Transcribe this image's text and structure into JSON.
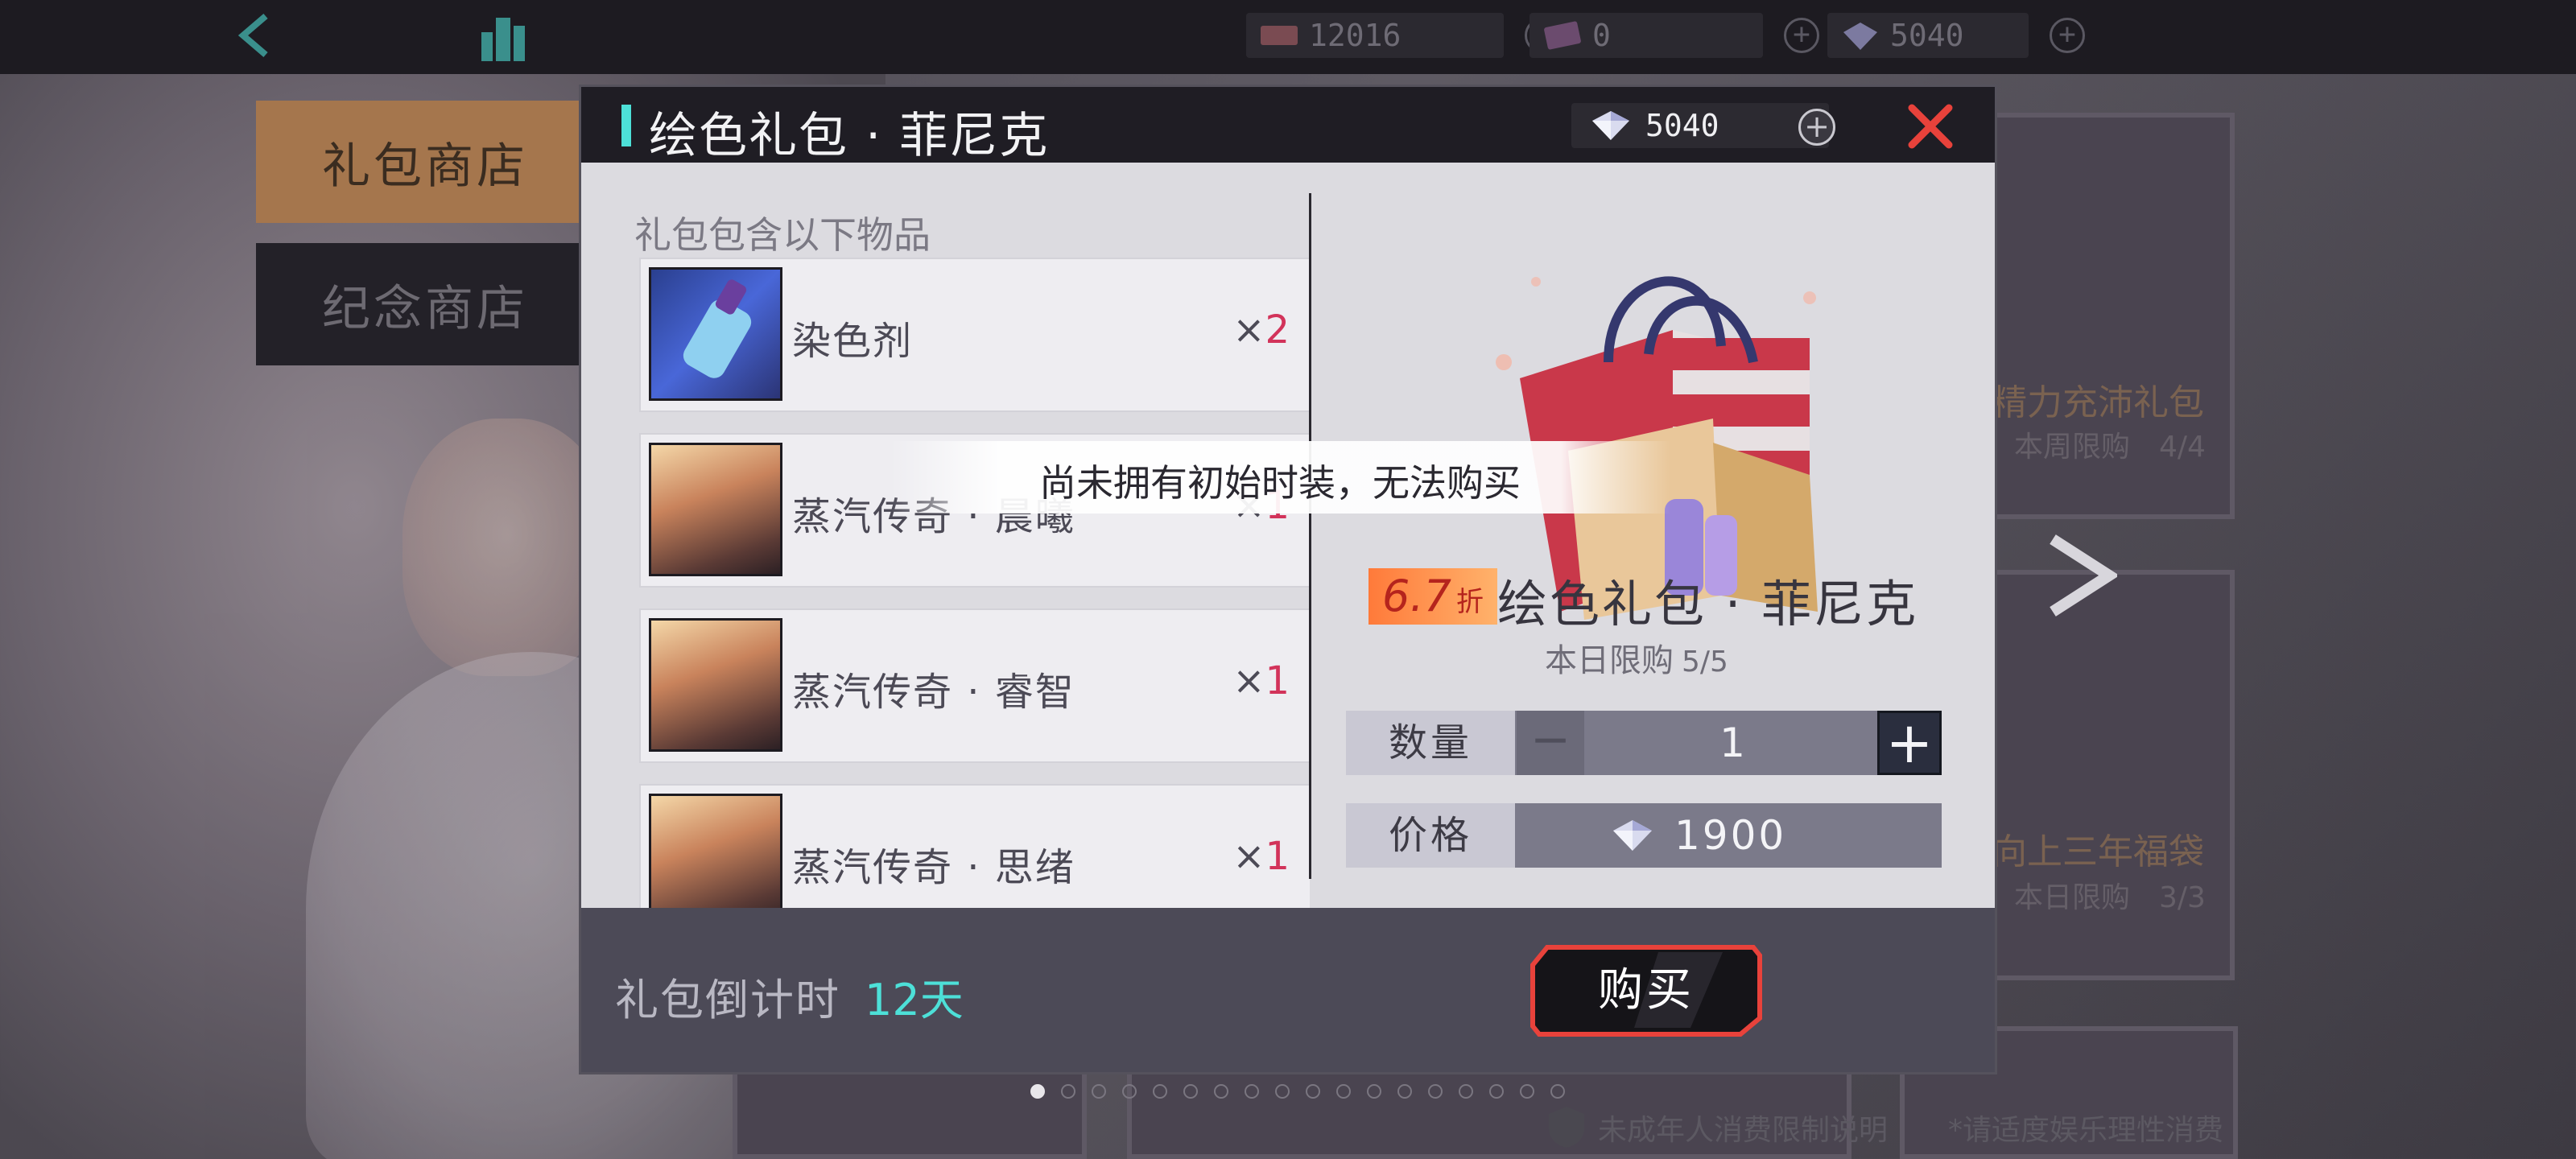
{
  "topbar": {
    "currencies": [
      {
        "name": "ticket",
        "value": "12016"
      },
      {
        "name": "coupon",
        "value": "0"
      },
      {
        "name": "gem",
        "value": "5040"
      }
    ]
  },
  "sidebar": {
    "tabs": [
      {
        "label": "礼包商店",
        "active": true
      },
      {
        "label": "纪念商店",
        "active": false
      }
    ]
  },
  "background_cards": [
    {
      "title": "精力充沛礼包",
      "sub": "本周限购　4/4"
    },
    {
      "title": "向上三年福袋",
      "sub": "本日限购　3/3"
    }
  ],
  "dialog": {
    "title": "绘色礼包 · 菲尼克",
    "gem_balance": "5040",
    "items_caption": "礼包包含以下物品",
    "items": [
      {
        "name": "染色剂",
        "qty_prefix": "×",
        "qty": "2"
      },
      {
        "name": "蒸汽传奇 · 晨曦",
        "qty_prefix": "×",
        "qty": "1"
      },
      {
        "name": "蒸汽传奇 · 睿智",
        "qty_prefix": "×",
        "qty": "1"
      },
      {
        "name": "蒸汽传奇 · 思绪",
        "qty_prefix": "×",
        "qty": "1"
      }
    ],
    "product": {
      "discount_value": "6.7",
      "discount_unit": "折",
      "name": "绘色礼包 · 菲尼克",
      "limit_label": "本日限购",
      "limit_value": "5/5"
    },
    "quantity": {
      "label": "数量",
      "minus": "−",
      "value": "1",
      "plus": "+"
    },
    "price": {
      "label": "价格",
      "value": "1900"
    },
    "footer": {
      "countdown_label": "礼包倒计时",
      "countdown_value": "12天",
      "buy_label": "购买"
    }
  },
  "toast": "尚未拥有初始时装，无法购买",
  "footer_notes": [
    "未成年人消费限制说明",
    "*请适度娱乐理性消费"
  ],
  "colors": {
    "accent_cyan": "#4de0d8",
    "close_red": "#e8423b",
    "qty_red": "#d2335a",
    "discount_orange": "#ff7a3a"
  }
}
